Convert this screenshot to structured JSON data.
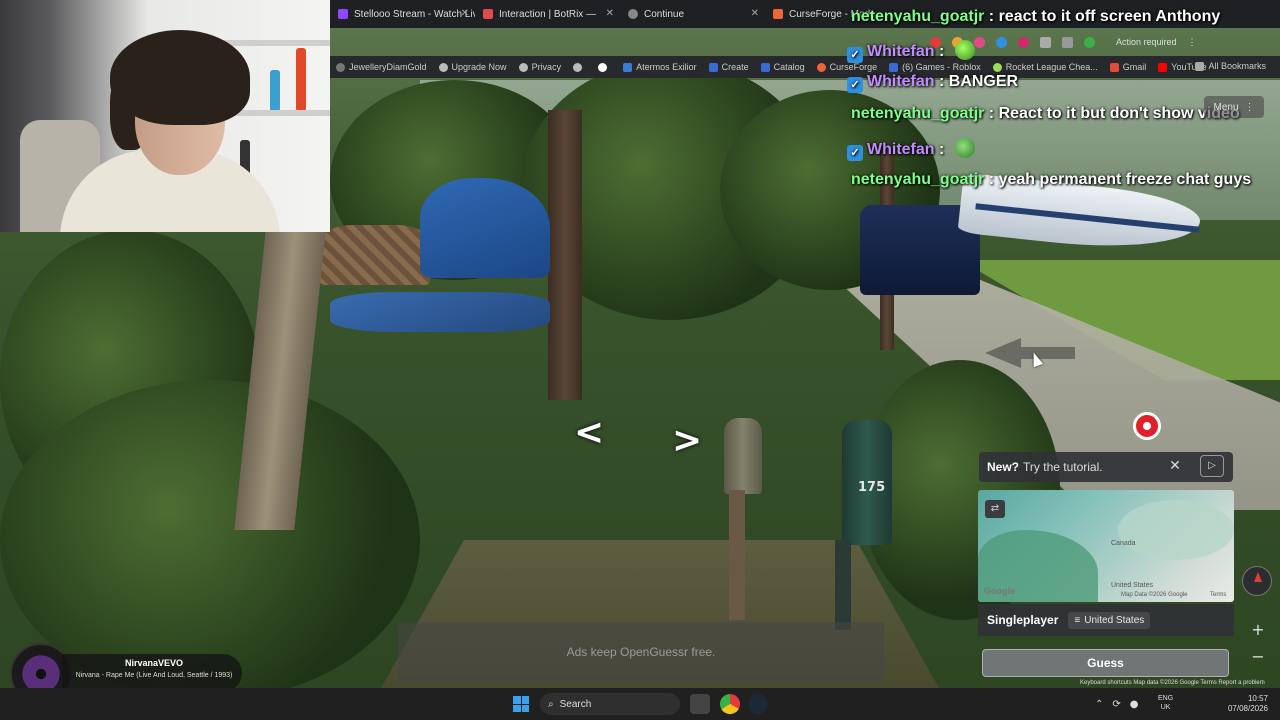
{
  "browser": {
    "tabs": [
      {
        "label": "Stellooo Stream - Watch Live",
        "color": "#9146ff"
      },
      {
        "label": "Interaction | BotRix — ",
        "color": "#e24b4b"
      },
      {
        "label": "Continue",
        "color": "#888888"
      },
      {
        "label": "CurseForge - Mods",
        "color": "#f16436"
      }
    ],
    "bookmarks": [
      "JewelleryDiamGold",
      "Upgrade Now",
      "Privacy",
      "",
      "",
      "Atermos Exilior",
      "Create",
      "Catalog",
      "CurseForge",
      "(6) Games - Roblox",
      "Rocket League Chea...",
      "Gmail",
      "YouTube"
    ],
    "all_bookmarks": "All Bookmarks",
    "action_required": "Action required"
  },
  "chat": {
    "messages": [
      {
        "user": "netenyahu_goatjr",
        "text": "react to it off screen Anthony",
        "color": "green",
        "badge": false
      },
      {
        "user": "Whitefan",
        "text": "",
        "color": "purple",
        "badge": true,
        "emote": true
      },
      {
        "user": "Whitefan",
        "text": "BANGER",
        "color": "purple",
        "badge": true
      },
      {
        "user": "netenyahu_goatjr",
        "text": "React to it but don't show video",
        "color": "green",
        "badge": false
      },
      {
        "user": "Whitefan",
        "text": "",
        "color": "purple",
        "badge": true,
        "emote": true
      },
      {
        "user": "netenyahu_goatjr",
        "text": "yeah permanent freeze chat guys",
        "color": "green",
        "badge": false
      }
    ],
    "separator": " : "
  },
  "game": {
    "menu_label": "Menu",
    "tutorial_bold": "New?",
    "tutorial_text": "Try the tutorial.",
    "mode": "Singleplayer",
    "country": "United States",
    "guess_label": "Guess",
    "ads_text": "Ads keep OpenGuessr free.",
    "mailbox_number": "175",
    "map_labels": {
      "canada": "Canada",
      "us": "United States",
      "google": "Google",
      "copyright": "Map Data ©2026 Google",
      "terms": "Terms"
    },
    "footer": "Keyboard shortcuts  Map data ©2026 Google  Terms  Report a problem"
  },
  "music": {
    "artist": "NirvanaVEVO",
    "song": "Nirvana - Rape Me (Live And Loud, Seattle / 1993)"
  },
  "taskbar": {
    "search_placeholder": "Search",
    "lang_line1": "ENG",
    "lang_line2": "UK",
    "time": "10:57",
    "date": "07/08/2026"
  },
  "colors": {
    "chat_green": "#7dff8a",
    "chat_purple": "#c08cff",
    "accent_blue": "#3aa0f0",
    "pin_red": "#e2202c"
  }
}
